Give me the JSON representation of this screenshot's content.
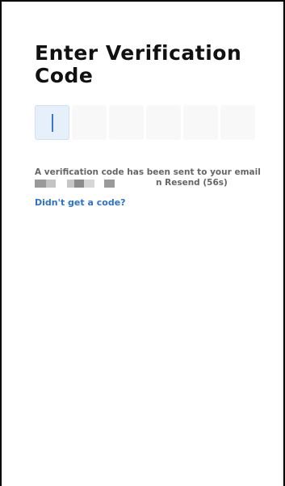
{
  "title": "Enter Verification Code",
  "code": {
    "digits": [
      "",
      "",
      "",
      "",
      "",
      ""
    ],
    "active_index": 0
  },
  "info": {
    "message": "A verification code has been sent to your email",
    "resend_label": "n Resend (56s)"
  },
  "help_link": "Didn't get a code?",
  "colors": {
    "link": "#2b73c9",
    "active_box": "#e5f0fb",
    "cursor": "#3b78c8"
  }
}
